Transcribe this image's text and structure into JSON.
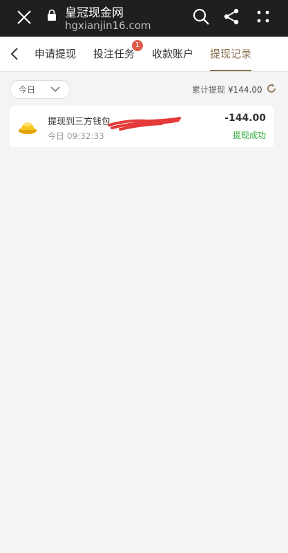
{
  "browser": {
    "site_title": "皇冠现金网",
    "site_url": "hgxianjin16.com",
    "icons": [
      "close-icon",
      "lock-icon",
      "search-icon",
      "share-icon",
      "more-icon"
    ]
  },
  "tabs": [
    {
      "label": "申请提现",
      "active": false
    },
    {
      "label": "投注任务",
      "active": false,
      "badge": "1"
    },
    {
      "label": "收款账户",
      "active": false
    },
    {
      "label": "提现记录",
      "active": true
    }
  ],
  "filter": {
    "date_value": "今日",
    "total_label": "累计提现",
    "total_amount": "¥144.00"
  },
  "records": [
    {
      "title": "提现到三方钱包",
      "time": "今日 09:32:33",
      "amount": "-144.00",
      "status": "提现成功"
    }
  ],
  "colors": {
    "accent": "#8a7350",
    "success": "#2fa83a",
    "badge": "#e05a4a",
    "redaction": "#e53a3a"
  }
}
